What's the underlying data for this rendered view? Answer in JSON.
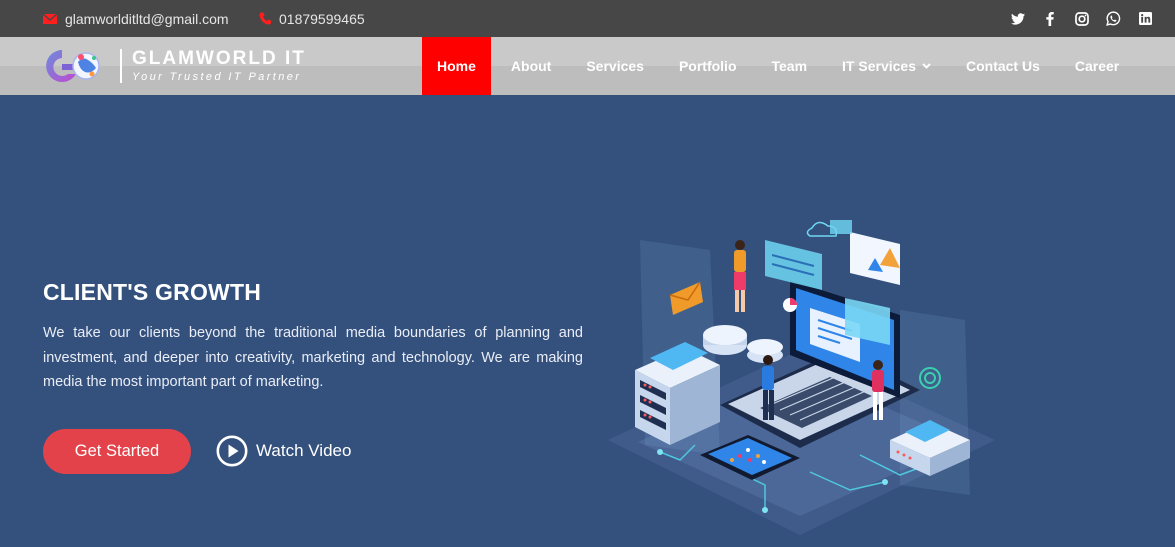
{
  "topbar": {
    "email": "glamworlditltd@gmail.com",
    "phone": "01879599465",
    "social_icons": [
      "twitter-icon",
      "facebook-icon",
      "instagram-icon",
      "whatsapp-icon",
      "linkedin-icon"
    ]
  },
  "brand": {
    "name": "GLAMWORLD IT",
    "tagline": "Your Trusted IT Partner"
  },
  "nav": {
    "items": [
      {
        "label": "Home",
        "active": true
      },
      {
        "label": "About"
      },
      {
        "label": "Services"
      },
      {
        "label": "Portfolio"
      },
      {
        "label": "Team"
      },
      {
        "label": "IT Services",
        "dropdown": true
      },
      {
        "label": "Contact Us"
      },
      {
        "label": "Career"
      }
    ]
  },
  "hero": {
    "title": "CLIENT'S GROWTH",
    "text": "We take our clients beyond the traditional media boundaries of planning and investment, and deeper into creativity, marketing and technology. We are making media the most important part of marketing.",
    "primary_button": "Get Started",
    "video_link": "Watch Video"
  },
  "colors": {
    "topbar_bg": "#474747",
    "navbar_bg": "#c4c4c4",
    "active_nav": "#ff0000",
    "hero_bg": "#34517e",
    "primary_button": "#e4424b",
    "contact_icon": "#ff1f1f"
  }
}
